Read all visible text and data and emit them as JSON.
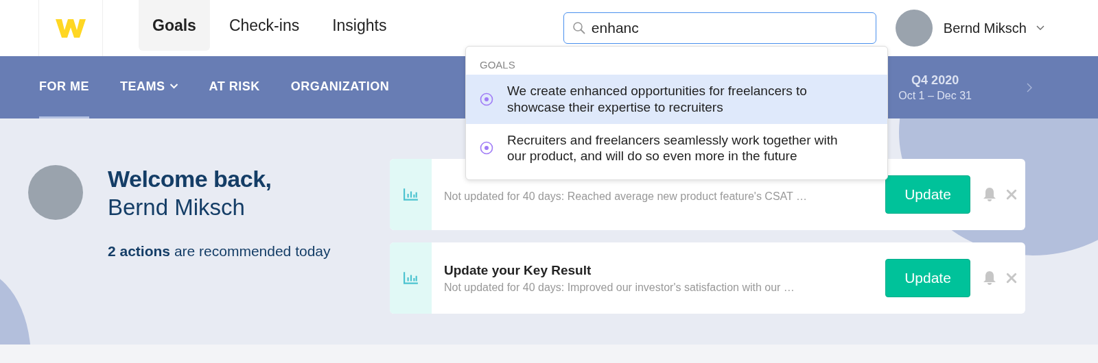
{
  "nav": {
    "tabs": [
      {
        "label": "Goals",
        "selected": true
      },
      {
        "label": "Check-ins",
        "selected": false
      },
      {
        "label": "Insights",
        "selected": false
      }
    ]
  },
  "search": {
    "value": "enhanc"
  },
  "user": {
    "name": "Bernd Miksch"
  },
  "subnav": {
    "items": [
      {
        "label": "FOR ME",
        "selected": true,
        "dropdown": false
      },
      {
        "label": "TEAMS",
        "selected": false,
        "dropdown": true
      },
      {
        "label": "AT RISK",
        "selected": false,
        "dropdown": false
      },
      {
        "label": "ORGANIZATION",
        "selected": false,
        "dropdown": false
      }
    ]
  },
  "period": {
    "quarter": "Q4 2020",
    "range": "Oct 1 – Dec 31"
  },
  "search_results": {
    "heading": "GOALS",
    "items": [
      {
        "text": "We create enhanced opportunities for freelancers to showcase their expertise to recruiters",
        "selected": true
      },
      {
        "text": "Recruiters and freelancers seamlessly work together with our product, and will do so even more in the future",
        "selected": false
      }
    ]
  },
  "welcome": {
    "greeting": "Welcome back,",
    "name": "Bernd Miksch",
    "summary": "**2 actions** are recommended today"
  },
  "actions": [
    {
      "description": "Not updated for 40 days: Reached average new product feature's CSAT …",
      "button": "Update"
    },
    {
      "title": "Update your Key Result",
      "description": "Not updated for 40 days: Improved our investor's satisfaction with our …",
      "button": "Update"
    }
  ]
}
